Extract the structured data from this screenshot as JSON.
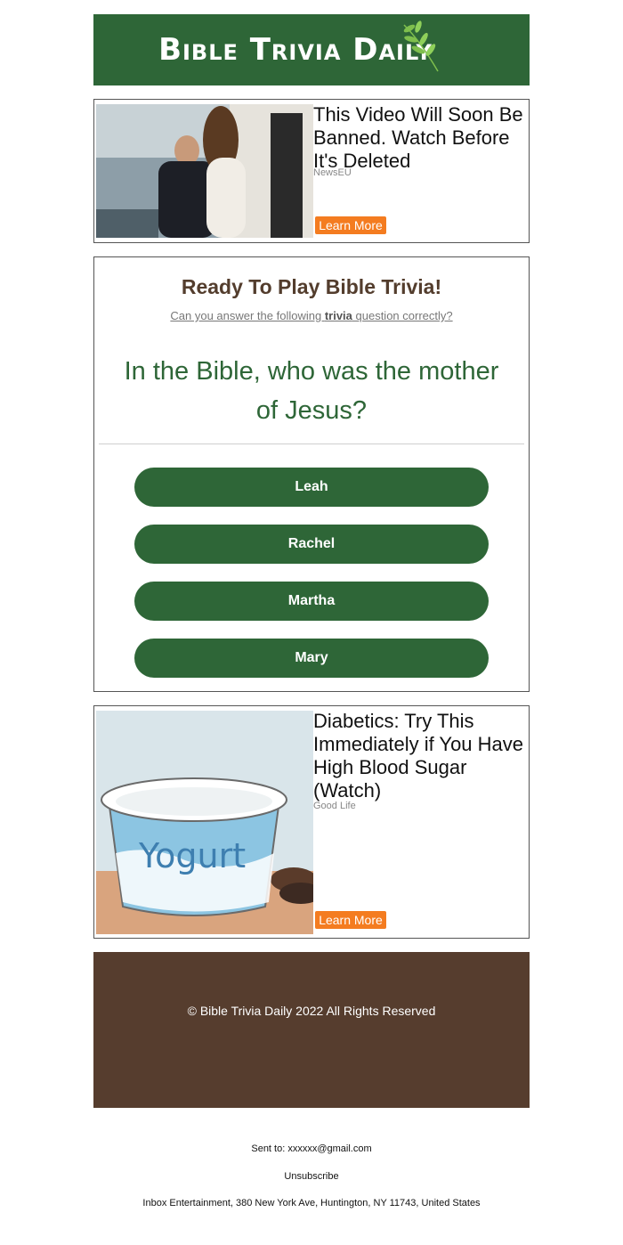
{
  "header": {
    "brand": "Bible Trivia Daily",
    "icon": "leaf-icon",
    "bg_color": "#2e6637"
  },
  "ads": [
    {
      "title": "This Video Will Soon Be Banned. Watch Before It's Deleted",
      "source": "NewsEU",
      "cta": "Learn More"
    },
    {
      "title": "Diabetics: Try This Immediately if You Have High Blood Sugar (Watch)",
      "source": "Good Life",
      "cta": "Learn More",
      "image_text": "Yogurt"
    }
  ],
  "trivia": {
    "heading": "Ready To Play Bible Trivia!",
    "sub_before": "Can you answer the following ",
    "sub_bold": "trivia",
    "sub_after": " question correctly?",
    "question": "In the Bible, who was the mother of Jesus?",
    "answers": [
      "Leah",
      "Rachel",
      "Martha",
      "Mary"
    ]
  },
  "footer": {
    "copyright": "© Bible Trivia Daily 2022 All Rights Reserved",
    "bg_color": "#563d2e"
  },
  "meta": {
    "sent_to": "Sent to: xxxxxx@gmail.com",
    "unsubscribe": "Unsubscribe",
    "address": "Inbox Entertainment, 380 New York Ave, Huntington, NY 11743, United States"
  },
  "colors": {
    "accent_green": "#2e6637",
    "cta_orange": "#f47c20",
    "heading_brown": "#533d2d"
  }
}
